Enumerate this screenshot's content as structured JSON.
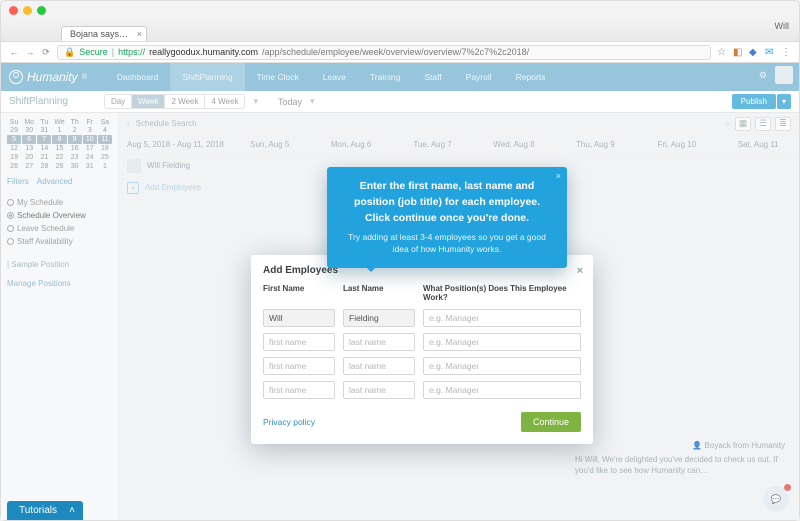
{
  "browser": {
    "window_user": "Will",
    "tab_title": "Bojana says…",
    "secure_label": "Secure",
    "url_prefix": "https://",
    "url_host": "reallygoodux.humanity.com",
    "url_path": "/app/schedule/employee/week/overview/overview/7%2c7%2c2018/"
  },
  "app": {
    "brand": "Humanity",
    "nav": [
      "Dashboard",
      "ShiftPlanning",
      "Time Clock",
      "Leave",
      "Training",
      "Staff",
      "Payroll",
      "Reports"
    ],
    "nav_active": 1,
    "sub_title": "ShiftPlanning",
    "range_options": [
      "Day",
      "Week",
      "2 Week",
      "4 Week"
    ],
    "range_active": 1,
    "today_label": "Today",
    "publish_label": "Publish"
  },
  "sidebar": {
    "dow": [
      "Su",
      "Mo",
      "Tu",
      "We",
      "Th",
      "Fr",
      "Sa"
    ],
    "weeks": [
      [
        "29",
        "30",
        "31",
        "1",
        "2",
        "3",
        "4"
      ],
      [
        "5",
        "6",
        "7",
        "8",
        "9",
        "10",
        "11"
      ],
      [
        "12",
        "13",
        "14",
        "15",
        "16",
        "17",
        "18"
      ],
      [
        "19",
        "20",
        "21",
        "22",
        "23",
        "24",
        "25"
      ],
      [
        "26",
        "27",
        "28",
        "29",
        "30",
        "31",
        "1"
      ]
    ],
    "sel_week": 1,
    "filters_label": "Filters",
    "advanced_label": "Advanced",
    "section": {
      "my_schedule": "My Schedule",
      "schedule_overview": "Schedule Overview",
      "leave_schedule": "Leave Schedule",
      "staff_avail": "Staff Availability"
    },
    "sample_position": "| Sample Position",
    "manage_positions": "Manage Positions"
  },
  "toolbar": {
    "search_placeholder": "Schedule Search",
    "date_range": "Aug 5, 2018 - Aug 11, 2018",
    "days": [
      "Sun, Aug 5",
      "Mon, Aug 6",
      "Tue, Aug 7",
      "Wed, Aug 8",
      "Thu, Aug 9",
      "Fri, Aug 10",
      "Sat, Aug 11"
    ],
    "employee_row": "Will Fielding",
    "add_employees_link": "Add Employees"
  },
  "coach": {
    "headline": "Enter the first name, last name and position (job title) for each employee. Click continue once you're done.",
    "sub": "Try adding at least 3-4 employees so you get a good idea of how Humanity works."
  },
  "modal": {
    "title": "Add Employees",
    "col_first": "First Name",
    "col_last": "Last Name",
    "col_pos": "What Position(s) Does This Employee Work?",
    "rows": [
      {
        "first": "Will",
        "last": "Fielding",
        "pos_placeholder": "e.g. Manager"
      },
      {
        "first_placeholder": "first name",
        "last_placeholder": "last name",
        "pos_placeholder": "e.g. Manager"
      },
      {
        "first_placeholder": "first name",
        "last_placeholder": "last name",
        "pos_placeholder": "e.g. Manager"
      },
      {
        "first_placeholder": "first name",
        "last_placeholder": "last name",
        "pos_placeholder": "e.g. Manager"
      }
    ],
    "privacy": "Privacy policy",
    "continue": "Continue"
  },
  "help": {
    "who": "Boyack from Humanity",
    "body": "Hi Will, We're delighted you've decided to check us out. If you'd like to see how Humanity can…"
  },
  "tutorials": {
    "label": "Tutorials"
  },
  "colors": {
    "header": "#7ab7d3",
    "accent": "#22a3dd",
    "continue": "#80b442",
    "publish": "#3ca7d8"
  }
}
